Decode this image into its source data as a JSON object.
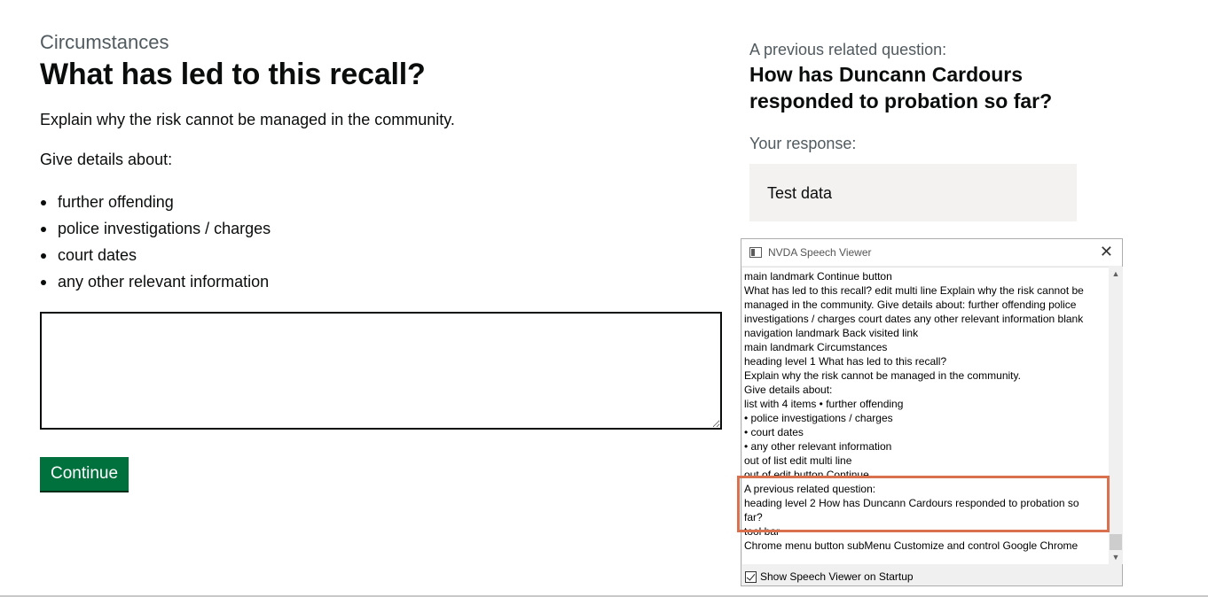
{
  "page": {
    "caption": "Circumstances",
    "title": "What has led to this recall?",
    "hint": "Explain why the risk cannot be managed in the community.",
    "details_label": "Give details about:",
    "bullets": [
      "further offending",
      "police investigations / charges",
      "court dates",
      "any other relevant information"
    ],
    "textarea_value": "",
    "continue_label": "Continue"
  },
  "previous": {
    "caption": "A previous related question:",
    "title": "How has Duncann Cardours responded to probation so far?",
    "response_label": "Your response:",
    "response_value": "Test data"
  },
  "nvda": {
    "title": "NVDA Speech Viewer",
    "close_glyph": "✕",
    "lines": [
      "main landmark    Continue  button",
      "What has led to this recall?  edit  multi line  Explain why the risk cannot be",
      "managed in the community. Give details about: further offending police",
      "investigations / charges court dates any other relevant information  blank",
      "navigation landmark    Back  visited  link",
      "main landmark    Circumstances",
      "heading    level 1  What has led to this recall?",
      "Explain why the risk cannot be managed in the community.",
      "Give details about:",
      "list  with 4 items  • further offending",
      "• police investigations / charges",
      "• court dates",
      "• any other relevant information",
      "out of list  edit  multi line",
      "out of edit  button    Continue",
      "A previous related question:",
      "heading    level 2  How has Duncann Cardours responded to probation so",
      "far?",
      "tool bar",
      "Chrome  menu button  subMenu  Customize and control Google Chrome"
    ],
    "scroll_up": "▲",
    "scroll_down": "▼",
    "checkbox_label": "Show Speech Viewer on Startup"
  },
  "colors": {
    "button": "#00703c",
    "highlight": "#d9714f",
    "response_bg": "#f3f2f1"
  }
}
